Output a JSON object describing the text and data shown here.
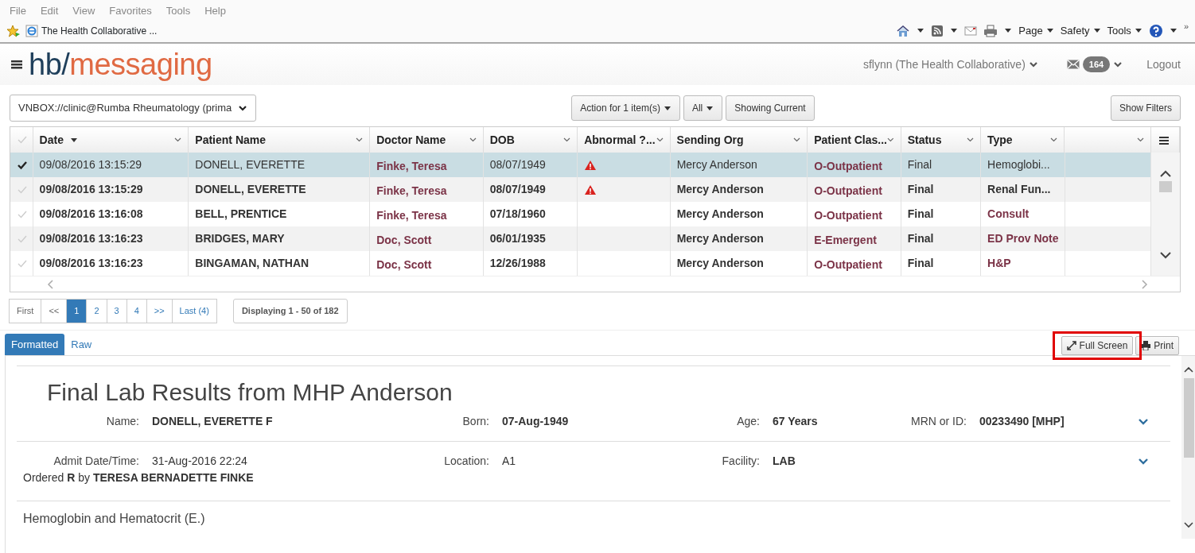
{
  "browser": {
    "menu": [
      "File",
      "Edit",
      "View",
      "Favorites",
      "Tools",
      "Help"
    ],
    "tab_title": "The Health Collaborative ...",
    "commands": [
      "Page",
      "Safety",
      "Tools"
    ],
    "overflow": "»"
  },
  "header": {
    "logo_prefix": "hb/",
    "logo_suffix": "messaging",
    "user": "sflynn (The Health Collaborative)",
    "message_count": "164",
    "logout": "Logout"
  },
  "toolbar": {
    "mailbox": "VNBOX://clinic@Rumba Rheumatology (prima",
    "buttons": [
      {
        "label": "Action for 1 item(s)",
        "dropdown": true
      },
      {
        "label": "All",
        "dropdown": true
      },
      {
        "label": "Showing Current",
        "dropdown": false
      }
    ],
    "filters_button": "Show Filters"
  },
  "table": {
    "all_selected": false,
    "columns": [
      {
        "label": "Date",
        "sorted": true
      },
      {
        "label": "Patient Name",
        "sorted": false
      },
      {
        "label": "Doctor Name",
        "sorted": false
      },
      {
        "label": "DOB",
        "sorted": false
      },
      {
        "label": "Abnormal ?...",
        "sorted": false
      },
      {
        "label": "Sending Org",
        "sorted": false
      },
      {
        "label": "Patient Clas...",
        "sorted": false
      },
      {
        "label": "Status",
        "sorted": false
      },
      {
        "label": "Type",
        "sorted": false
      }
    ],
    "rows": [
      {
        "selected": true,
        "unread": false,
        "date": "09/08/2016 13:15:29",
        "patient": "DONELL, EVERETTE",
        "doctor": "Finke, Teresa",
        "dob": "08/07/1949",
        "abnormal": true,
        "sending_org": "Mercy Anderson",
        "patient_class": "O-Outpatient",
        "status": "Final",
        "type": "Hemoglobi..."
      },
      {
        "selected": false,
        "unread": true,
        "date": "09/08/2016 13:15:29",
        "patient": "DONELL, EVERETTE",
        "doctor": "Finke, Teresa",
        "dob": "08/07/1949",
        "abnormal": true,
        "sending_org": "Mercy Anderson",
        "patient_class": "O-Outpatient",
        "status": "Final",
        "type": "Renal Fun..."
      },
      {
        "selected": false,
        "unread": true,
        "date": "09/08/2016 13:16:08",
        "patient": "BELL, PRENTICE",
        "doctor": "Finke, Teresa",
        "dob": "07/18/1960",
        "abnormal": false,
        "sending_org": "Mercy Anderson",
        "patient_class": "O-Outpatient",
        "status": "Final",
        "type": "Consult"
      },
      {
        "selected": false,
        "unread": true,
        "date": "09/08/2016 13:16:23",
        "patient": "BRIDGES, MARY",
        "doctor": "Doc, Scott",
        "dob": "06/01/1935",
        "abnormal": false,
        "sending_org": "Mercy Anderson",
        "patient_class": "E-Emergent",
        "status": "Final",
        "type": "ED Prov Note"
      },
      {
        "selected": false,
        "unread": true,
        "date": "09/08/2016 13:16:23",
        "patient": "BINGAMAN, NATHAN",
        "doctor": "Doc, Scott",
        "dob": "12/26/1988",
        "abnormal": false,
        "sending_org": "Mercy Anderson",
        "patient_class": "O-Outpatient",
        "status": "Final",
        "type": "H&P"
      }
    ]
  },
  "pagination": {
    "first": "First",
    "prev": "<<",
    "pages": [
      {
        "label": "1",
        "selected": true
      },
      {
        "label": "2",
        "selected": false
      },
      {
        "label": "3",
        "selected": false
      },
      {
        "label": "4",
        "selected": false
      }
    ],
    "next": ">>",
    "last": "Last (4)",
    "summary": "Displaying 1 - 50 of 182"
  },
  "viewer": {
    "tabs": [
      {
        "label": "Formatted",
        "selected": true
      },
      {
        "label": "Raw",
        "selected": false
      }
    ],
    "actions": [
      {
        "label": "Full Screen",
        "kind": "fullscreen",
        "highlighted": true
      },
      {
        "label": "Print",
        "kind": "print",
        "highlighted": false
      }
    ]
  },
  "document": {
    "title": "Final Lab Results from MHP Anderson",
    "sections": [
      {
        "fields": [
          {
            "label": "Name:",
            "value": "DONELL, EVERETTE F"
          },
          {
            "label": "Born:",
            "value": "07-Aug-1949"
          },
          {
            "label": "Age:",
            "value": "67 Years"
          },
          {
            "label": "MRN or ID:",
            "value": "00233490 [MHP]"
          }
        ]
      },
      {
        "fields": [
          {
            "label": "Admit Date/Time:",
            "value": "31-Aug-2016 22:24"
          },
          {
            "label": "Location:",
            "value": "A1"
          },
          {
            "label": "Facility:",
            "value": "LAB"
          }
        ],
        "note": "Ordered **R** by **TERESA BERNADETTE FINKE**"
      }
    ],
    "next_heading": "Hemoglobin and Hematocrit (E.)"
  }
}
